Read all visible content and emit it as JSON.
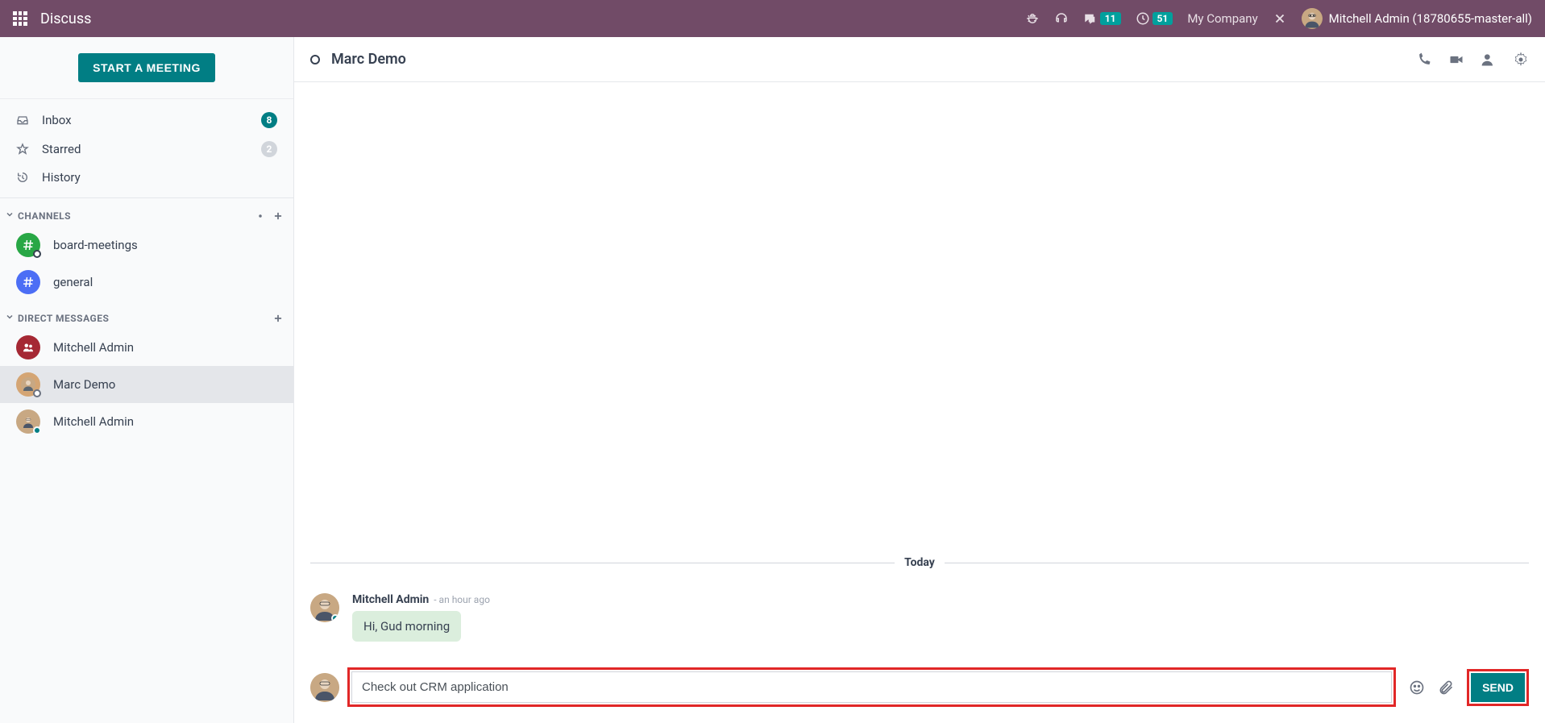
{
  "topbar": {
    "title": "Discuss",
    "chat_count": "11",
    "activity_count": "51",
    "company": "My Company",
    "user_name": "Mitchell Admin (18780655-master-all)"
  },
  "sidebar": {
    "meeting_button": "START A MEETING",
    "mailboxes": [
      {
        "label": "Inbox",
        "count": "8",
        "pill_class": "pill"
      },
      {
        "label": "Starred",
        "count": "2",
        "pill_class": "pill pill-grey"
      },
      {
        "label": "History",
        "count": "",
        "pill_class": ""
      }
    ],
    "channels_header": "CHANNELS",
    "channels": [
      {
        "name": "board-meetings",
        "color": "ch-green"
      },
      {
        "name": "general",
        "color": "ch-blue"
      }
    ],
    "dm_header": "DIRECT MESSAGES",
    "dms": [
      {
        "name": "Mitchell Admin",
        "status": "none",
        "active": false,
        "color": "ch-red",
        "group": true
      },
      {
        "name": "Marc Demo",
        "status": "offline",
        "active": true,
        "color": "",
        "group": false
      },
      {
        "name": "Mitchell Admin",
        "status": "online",
        "active": false,
        "color": "",
        "group": false
      }
    ]
  },
  "thread": {
    "title": "Marc Demo",
    "day_label": "Today",
    "messages": [
      {
        "author": "Mitchell Admin",
        "time": "- an hour ago",
        "text": "Hi, Gud morning"
      }
    ],
    "composer_value": "Check out CRM application",
    "send_label": "SEND"
  }
}
